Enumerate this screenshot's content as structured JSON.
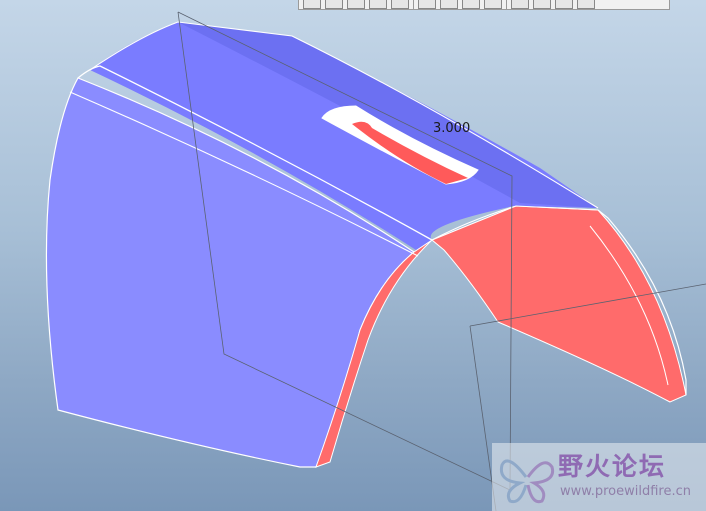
{
  "viewport": {
    "background_top": "#c4d6e8",
    "background_bottom": "#7a97b8"
  },
  "model": {
    "surface_color": "#8080ff",
    "section_color": "#ff6b6b",
    "edge_color": "#ffffff"
  },
  "dimension": {
    "value": "3.000"
  },
  "watermark": {
    "site_name_cn": "野火论坛",
    "site_url": "www.proewildfire.cn"
  },
  "toolbar": {
    "icons": [
      "view-icon",
      "select-icon",
      "layer-icon",
      "sphere-icon",
      "appearance-icon",
      "orient-icon",
      "save-icon",
      "measure-icon",
      "spin-icon",
      "datum-icon",
      "datum-icon",
      "datum-icon",
      "annotation-icon"
    ]
  }
}
